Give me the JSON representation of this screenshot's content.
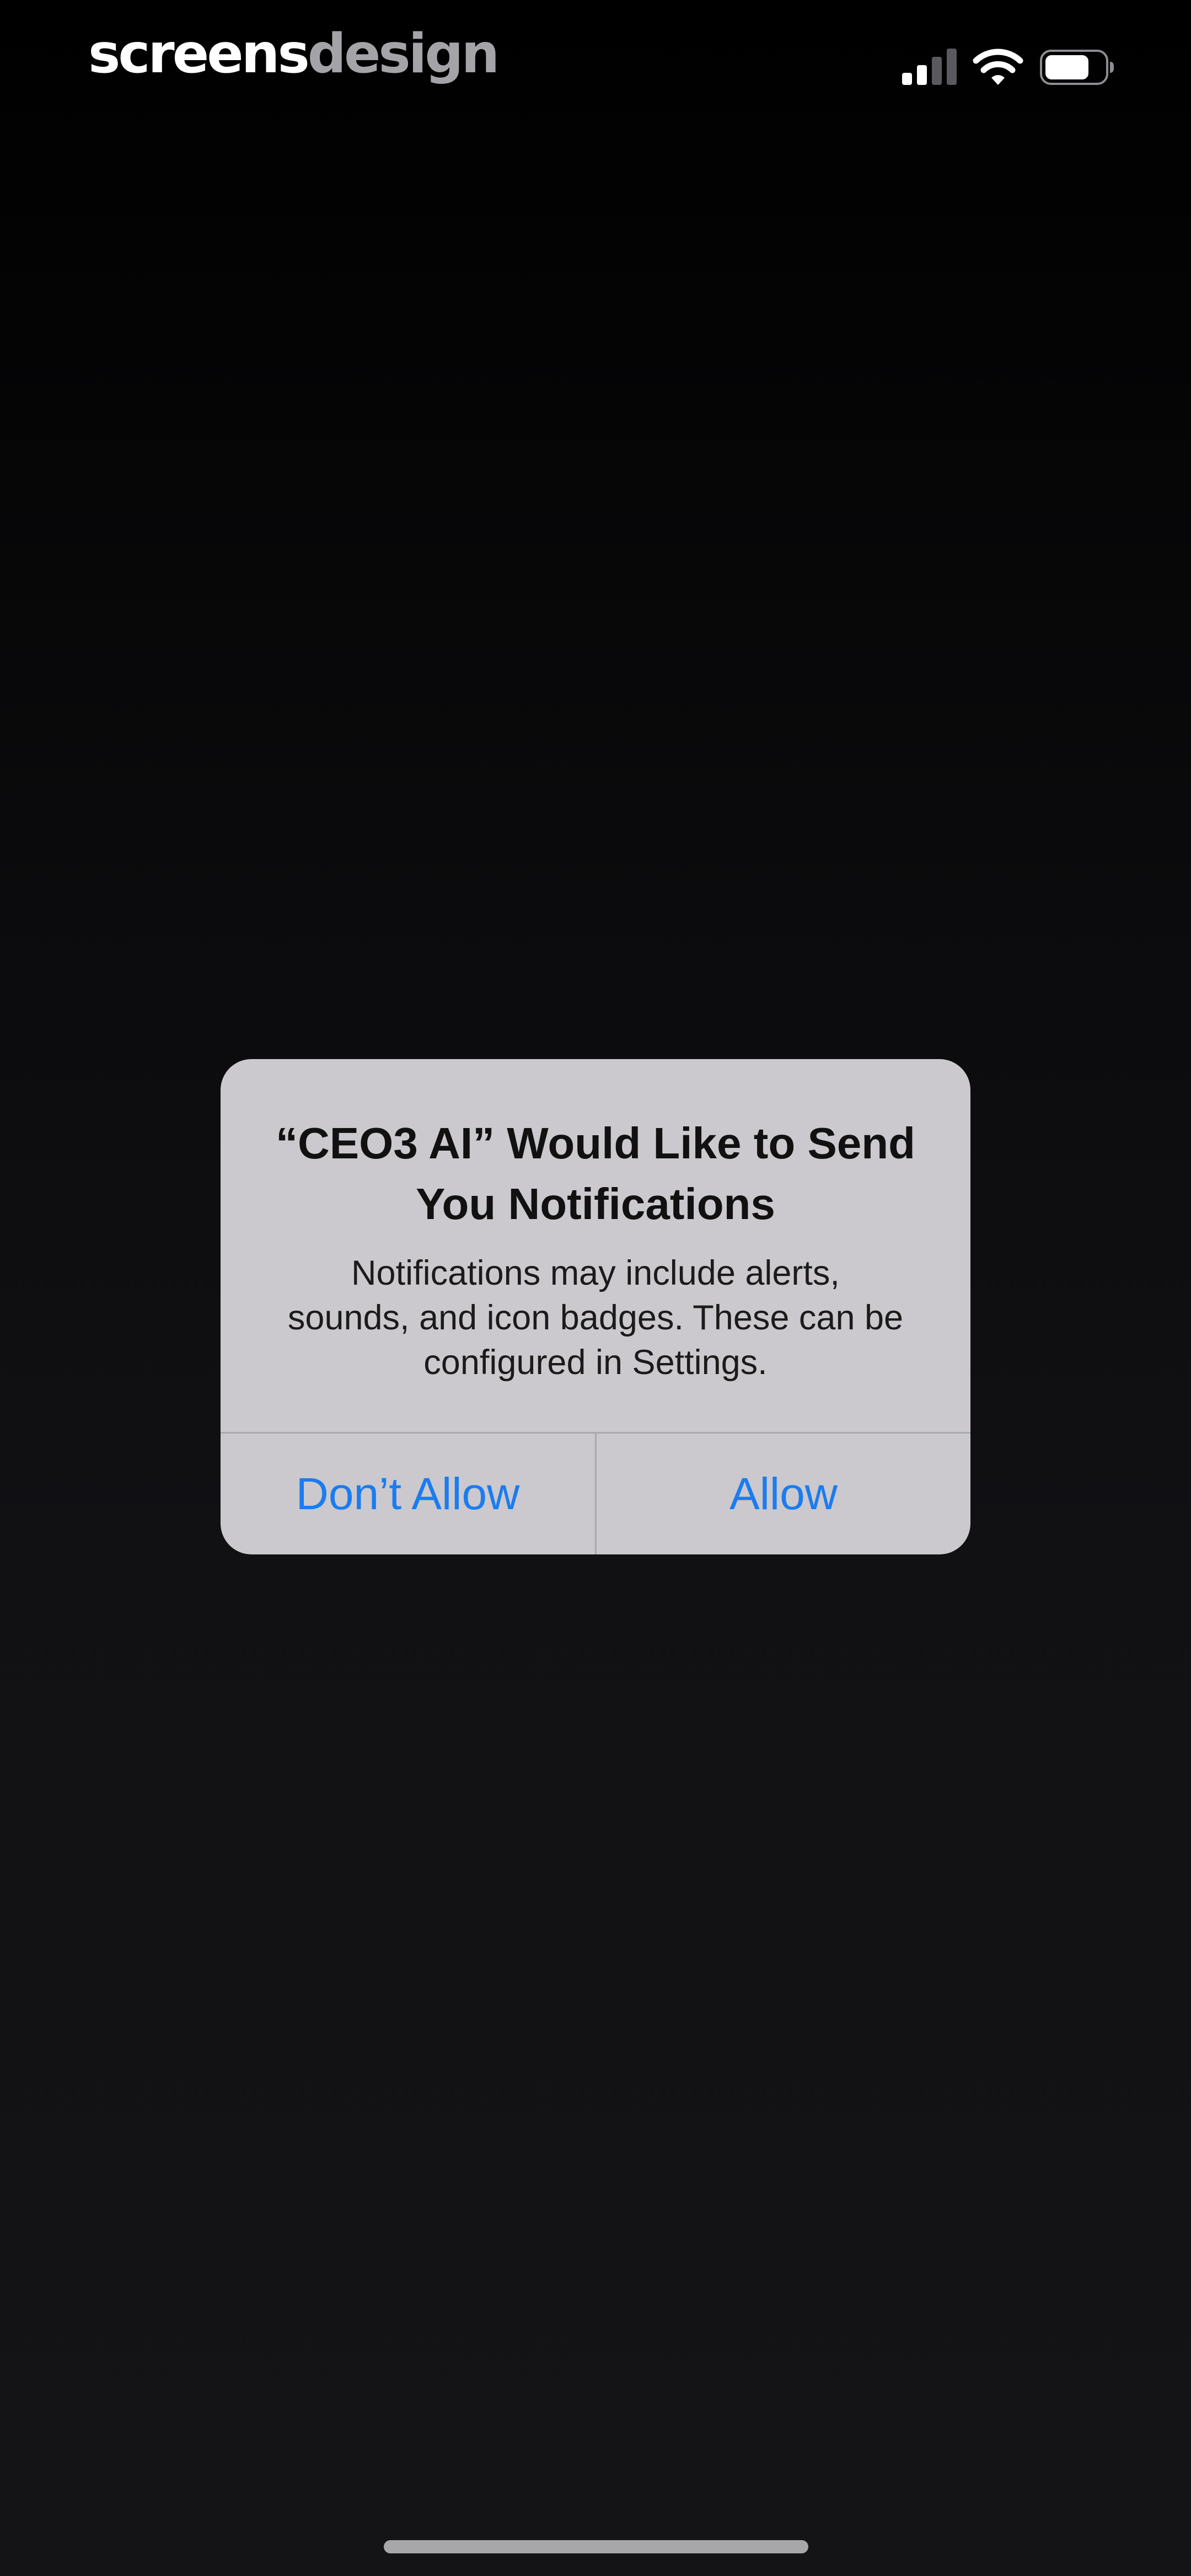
{
  "status_bar": {
    "brand_part_a": "screens",
    "brand_part_b": "design",
    "icons": [
      "cellular-signal-icon",
      "wifi-icon",
      "battery-icon"
    ]
  },
  "alert": {
    "title": "“CEO3 AI” Would Like to Send You Notifications",
    "message": "Notifications may include alerts, sounds, and icon badges. These can be configured in Settings.",
    "buttons": {
      "deny_label": "Don’t Allow",
      "allow_label": "Allow"
    }
  },
  "colors": {
    "background": "#000000",
    "alert_background": "#cbc9cd",
    "button_text": "#1a7cf0",
    "brand_primary": "#ffffff",
    "brand_secondary": "#a4a4a8"
  }
}
